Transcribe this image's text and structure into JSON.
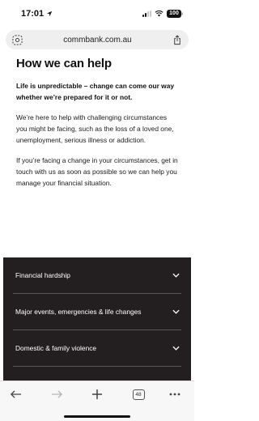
{
  "status_bar": {
    "time": "17:01",
    "battery": "100"
  },
  "browser": {
    "url": "commbank.com.au",
    "tab_count": "48"
  },
  "page": {
    "heading": "How we can help",
    "lead": "Life is unpredictable – change can come our way whether we’re prepared for it or not.",
    "para1": "We’re here to help with challenging circumstances you might be facing, such as the loss of a loved one, unemployment, serious illness or addiction.",
    "para2": "If you’re facing a change in your circumstances, get in touch with us as soon as possible so we can help you manage your financial situation."
  },
  "accordion": [
    {
      "label": "Financial hardship"
    },
    {
      "label": "Major events, emergencies & life changes"
    },
    {
      "label": "Domestic & family violence"
    }
  ],
  "colors": {
    "accordion_bg": "#231f20",
    "address_bg": "#efefef"
  }
}
